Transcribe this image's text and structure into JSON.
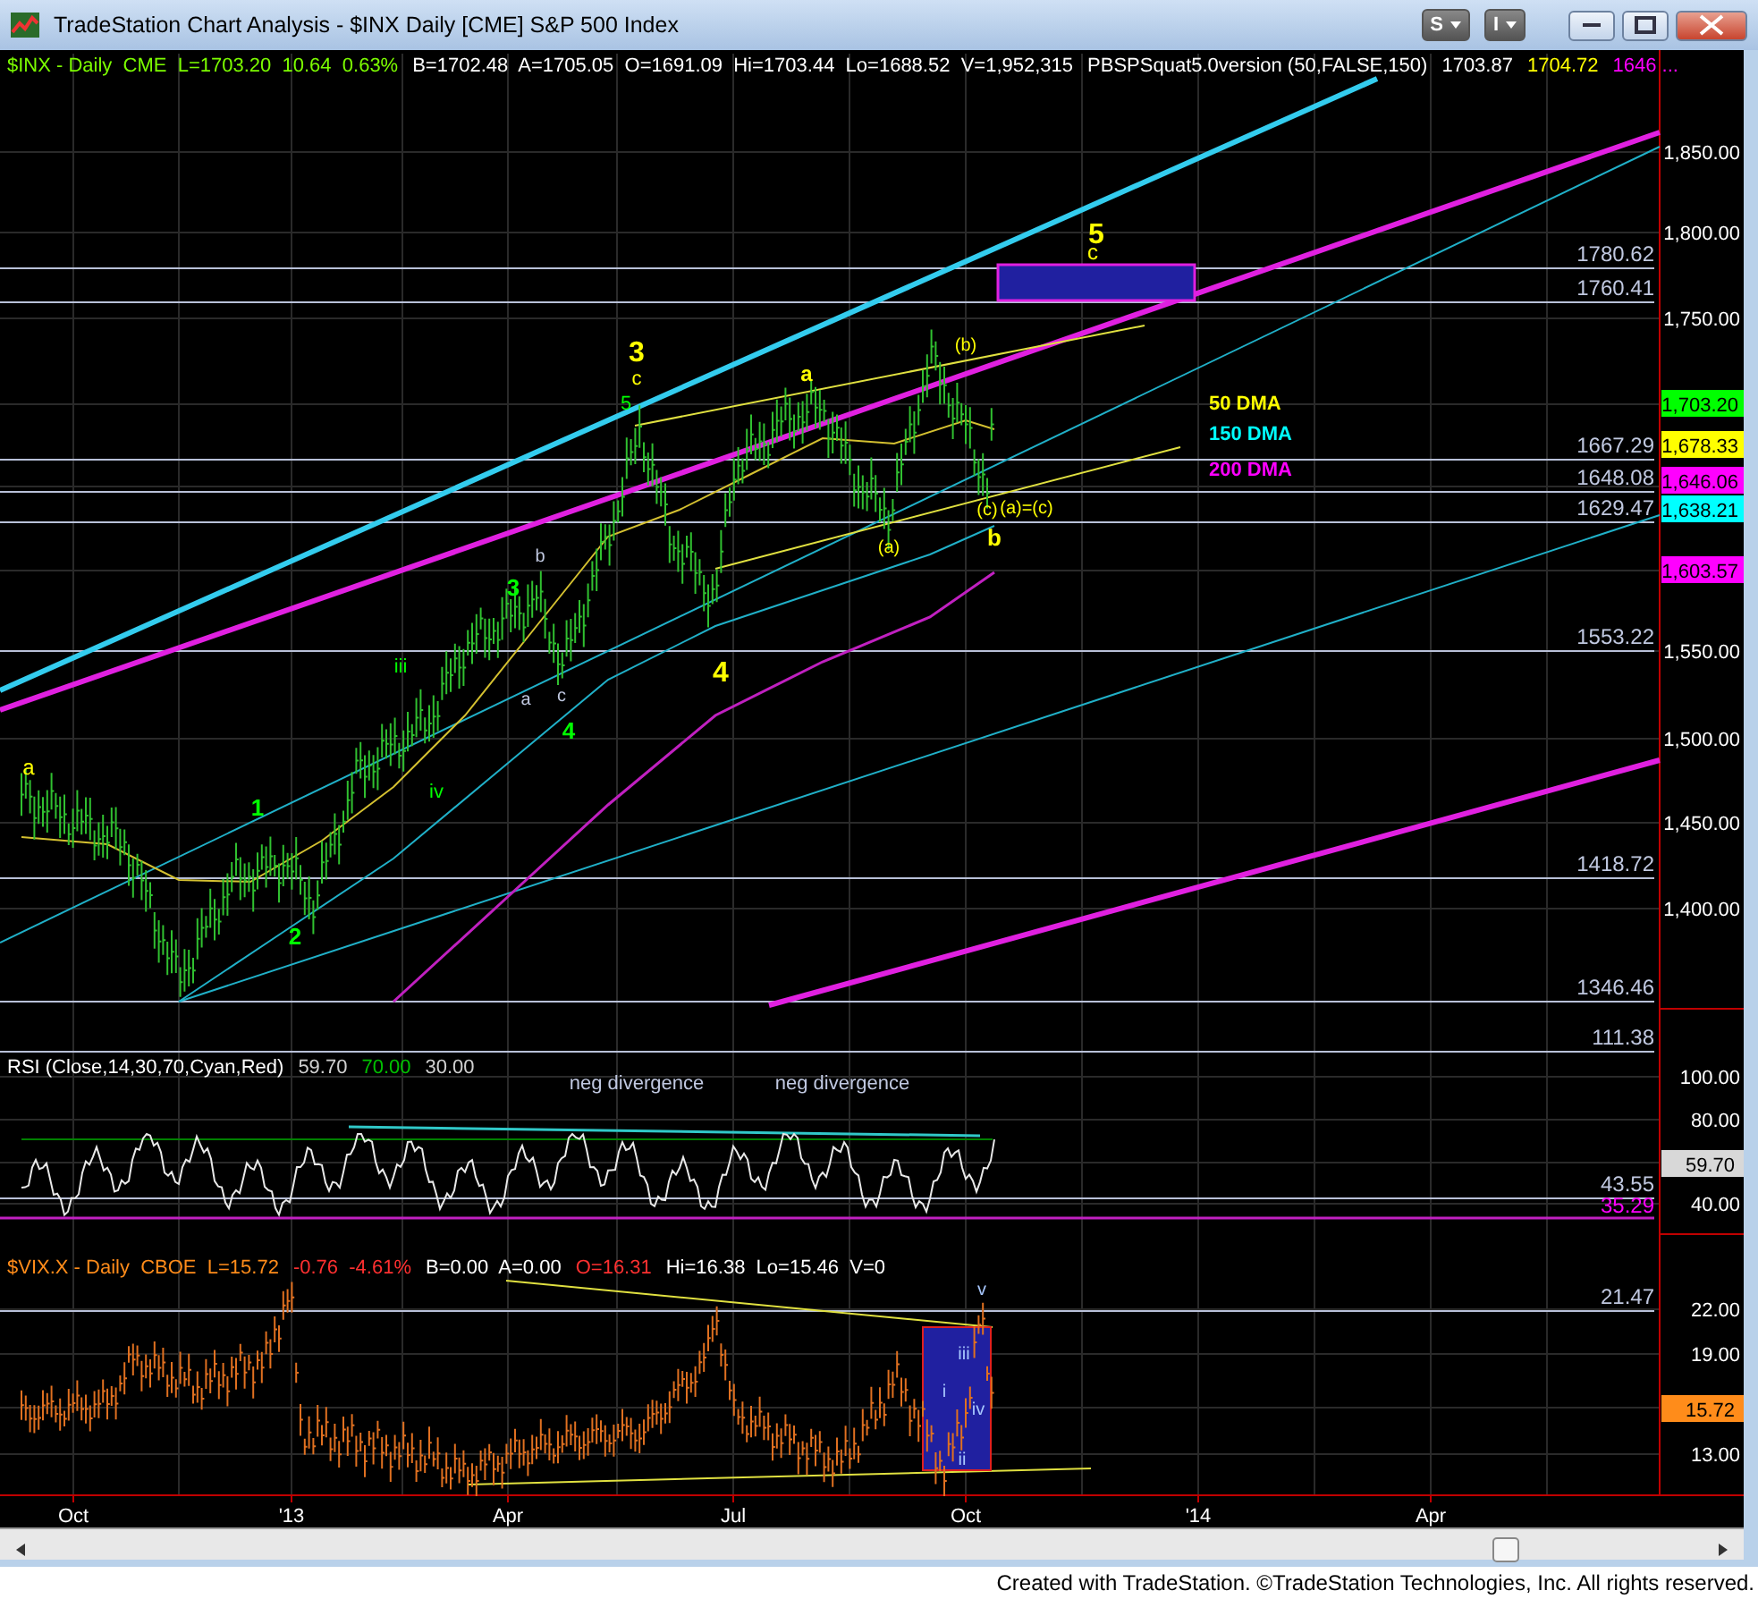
{
  "window": {
    "title": "TradeStation Chart Analysis - $INX Daily [CME] S&P 500 Index",
    "menu_buttons": [
      "S",
      "I"
    ]
  },
  "price_pane": {
    "legend": [
      {
        "text": "$INX - Daily  CME  L=1703.20  10.64  0.63%",
        "color": "#7cfc00"
      },
      {
        "text": "B=1702.48  A=1705.05  O=1691.09  Hi=1703.44  Lo=1688.52  V=1,952,315",
        "color": "#ffffff"
      },
      {
        "text": "PBSPSquat5.0version (50,FALSE,150)",
        "color": "#ffffff"
      },
      {
        "text": "1703.87",
        "color": "#ffffff"
      },
      {
        "text": "1704.72",
        "color": "#ffff00"
      },
      {
        "text": "1646 ...",
        "color": "#ff00ff"
      }
    ],
    "axis_labels": [
      "1,850.00",
      "1,800.00",
      "1,750.00",
      "1,550.00",
      "1,500.00",
      "1,450.00",
      "1,400.00"
    ],
    "price_tags": [
      {
        "text": "1,703.20",
        "color": "#00ff00"
      },
      {
        "text": "1,678.33",
        "color": "#ffff00"
      },
      {
        "text": "1,646.06",
        "color": "#ff00ff"
      },
      {
        "text": "1,638.21",
        "color": "#00ffff"
      },
      {
        "text": "1,603.57",
        "color": "#ff00ff"
      }
    ],
    "level_labels": [
      "1780.62",
      "1760.41",
      "1667.29",
      "1648.08",
      "1629.47",
      "1553.22",
      "1418.72",
      "1346.46"
    ],
    "wave_labels": [
      {
        "text": "5",
        "color": "#ffff00"
      },
      {
        "text": "c",
        "color": "#ffff00"
      },
      {
        "text": "3",
        "color": "#ffff00"
      },
      {
        "text": "c",
        "color": "#ffff00"
      },
      {
        "text": "5",
        "color": "#00ff00"
      },
      {
        "text": "a",
        "color": "#ffff00"
      },
      {
        "text": "(b)",
        "color": "#ffff00"
      },
      {
        "text": "(c)",
        "color": "#ffff00"
      },
      {
        "text": "b",
        "color": "#ffff00"
      },
      {
        "text": "(a)",
        "color": "#ffff00"
      },
      {
        "text": "(a)=(c)",
        "color": "#ffff00"
      },
      {
        "text": "4",
        "color": "#ffff00"
      },
      {
        "text": "3",
        "color": "#00ff00"
      },
      {
        "text": "b",
        "color": "#c0c8e0"
      },
      {
        "text": "c",
        "color": "#c0c8e0"
      },
      {
        "text": "a",
        "color": "#c0c8e0"
      },
      {
        "text": "4",
        "color": "#00ff00"
      },
      {
        "text": "iii",
        "color": "#00ff00"
      },
      {
        "text": "iv",
        "color": "#00ff00"
      },
      {
        "text": "1",
        "color": "#00ff00"
      },
      {
        "text": "2",
        "color": "#00ff00"
      },
      {
        "text": "a",
        "color": "#ffff00"
      }
    ],
    "ma_labels": [
      {
        "text": "50 DMA",
        "color": "#ffff00"
      },
      {
        "text": "150 DMA",
        "color": "#00ffff"
      },
      {
        "text": "200 DMA",
        "color": "#ff00ff"
      }
    ]
  },
  "rsi_pane": {
    "legend": [
      {
        "text": "RSI (Close,14,30,70,Cyan,Red)",
        "color": "#ffffff"
      },
      {
        "text": "59.70",
        "color": "#d0d0d0"
      },
      {
        "text": "70.00",
        "color": "#00c000"
      },
      {
        "text": "30.00",
        "color": "#d0d0d0"
      }
    ],
    "axis_labels": [
      "100.00",
      "80.00",
      "40.00"
    ],
    "value_tag": "59.70",
    "level_labels": [
      {
        "text": "111.38",
        "color": "#c0c8e0"
      },
      {
        "text": "43.55",
        "color": "#c0c8e0"
      },
      {
        "text": "35.29",
        "color": "#ff00ff"
      }
    ],
    "notes": [
      "neg divergence",
      "neg divergence"
    ]
  },
  "vix_pane": {
    "legend": [
      {
        "text": "$VIX.X - Daily  CBOE  L=15.72",
        "color": "#ff8c1a"
      },
      {
        "text": "-0.76  -4.61%",
        "color": "#ff3030"
      },
      {
        "text": "B=0.00  A=0.00",
        "color": "#ffffff"
      },
      {
        "text": "O=16.31",
        "color": "#ff3030"
      },
      {
        "text": "Hi=16.38  Lo=15.46  V=0",
        "color": "#ffffff"
      }
    ],
    "axis_labels": [
      "22.00",
      "19.00",
      "13.00"
    ],
    "value_tag": "15.72",
    "level_label": "21.47",
    "wave_labels": [
      "v",
      "iii",
      "i",
      "iv",
      "ii"
    ]
  },
  "time_axis": [
    "Oct",
    "'13",
    "Apr",
    "Jul",
    "Oct",
    "'14",
    "Apr"
  ],
  "footer": "Created with TradeStation. ©TradeStation Technologies, Inc. All rights reserved."
}
